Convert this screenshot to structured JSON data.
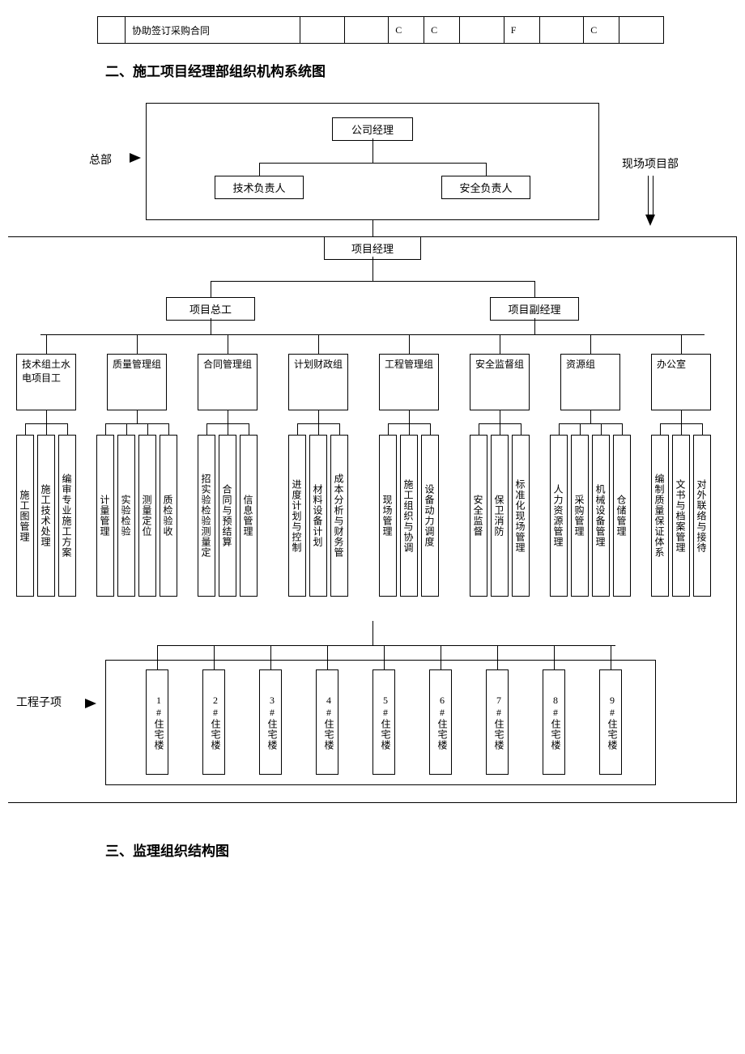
{
  "top_table": {
    "col1": "",
    "col2": "协助签订采购合同",
    "c3": "",
    "c4": "",
    "c5": "C",
    "c6": "C",
    "c7": "",
    "c8": "F",
    "c9": "",
    "c10": "C",
    "c11": ""
  },
  "heading2": "二、施工项目经理部组织机构系统图",
  "heading3": "三、监理组织结构图",
  "labels": {
    "hq": "总部",
    "site": "现场项目部",
    "subproj": "工程子项"
  },
  "top": {
    "ceo": "公司经理",
    "tech_lead": "技术负责人",
    "safety_lead": "安全负责人"
  },
  "pm": "项目经理",
  "deputies": {
    "chief_eng": "项目总工",
    "deputy_pm": "项目副经理"
  },
  "groups": [
    "技术组土水电项目工",
    "质量管理组",
    "合同管理组",
    "计划财政组",
    "工程管理组",
    "安全监督组",
    "资源组",
    "办公室"
  ],
  "tasks": [
    [
      "施工图管理",
      "施工技术处理",
      "编审专业施工方案"
    ],
    [
      "计量管理",
      "实验检验",
      "测量定位",
      "质检验收"
    ],
    [
      "招实验检验测量定",
      "合同与预结算",
      "信息管理"
    ],
    [
      "进度计划与控制",
      "材料设备计划",
      "成本分析与财务管"
    ],
    [
      "现场管理",
      "施工组织与协调",
      "设备动力调度"
    ],
    [
      "安全监督",
      "保卫消防",
      "标准化现场管理"
    ],
    [
      "人力资源管理",
      "采购管理",
      "机械设备管理",
      "仓储管理"
    ],
    [
      "编制质量保证体系",
      "文书与档案管理",
      "对外联络与接待"
    ]
  ],
  "subprojects": [
    "1#住宅楼",
    "2#住宅楼",
    "3#住宅楼",
    "4#住宅楼",
    "5#住宅楼",
    "6#住宅楼",
    "7#住宅楼",
    "8#住宅楼",
    "9#住宅楼"
  ]
}
